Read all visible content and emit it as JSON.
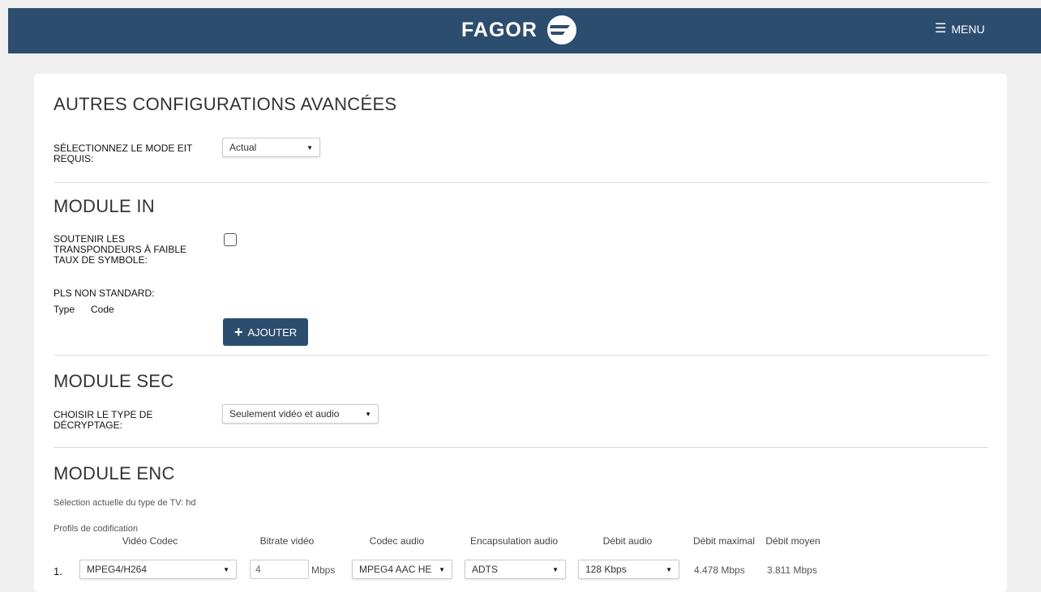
{
  "header": {
    "logo_text": "FAGOR",
    "menu_label": "MENU",
    "bg_color": "#2d4d6f"
  },
  "advanced": {
    "title": "AUTRES CONFIGURATIONS AVANCÉES",
    "eit_label_line1": "SÉLECTIONNEZ LE MODE EIT",
    "eit_label_line2": "REQUIS:",
    "eit_value": "Actual"
  },
  "module_in": {
    "title": "MODULE IN",
    "support_line1": "SOUTENIR LES",
    "support_line2": "TRANSPONDEURS À FAIBLE",
    "support_line3": "TAUX DE SYMBOLE:",
    "pls_label": "PLS NON STANDARD:",
    "col_type": "Type",
    "col_code": "Code",
    "add_label": "AJOUTER"
  },
  "module_sec": {
    "title": "MODULE SEC",
    "label_line1": "CHOISIR LE TYPE DE",
    "label_line2": "DÉCRYPTAGE:",
    "value": "Seulement vidéo et audio"
  },
  "module_enc": {
    "title": "MODULE ENC",
    "tv_type": "Sélection actuelle du type de TV: hd",
    "profiles_label": "Profils de codification",
    "headers": {
      "video_codec": "Vidéo Codec",
      "video_bitrate": "Bitrate vidéo",
      "audio_codec": "Codec audio",
      "audio_encap": "Encapsulation audio",
      "audio_rate": "Débit audio",
      "max_rate": "Débit maximal",
      "avg_rate": "Débit moyen"
    },
    "rows": [
      {
        "index": "1.",
        "video_codec": "MPEG4/H264",
        "bitrate": "4",
        "unit": "Mbps",
        "audio_codec": "MPEG4 AAC HE",
        "encap": "ADTS",
        "audio_rate": "128 Kbps",
        "max_rate": "4.478 Mbps",
        "avg_rate": "3.811 Mbps"
      }
    ]
  }
}
